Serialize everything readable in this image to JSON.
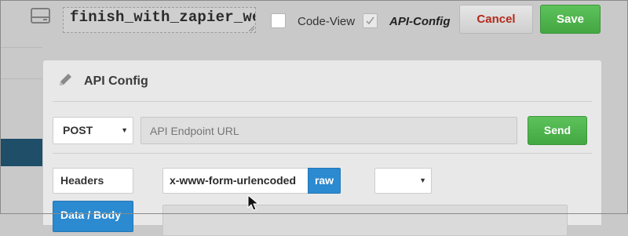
{
  "toolbar": {
    "flow_icon": "computer-icon",
    "flow_name": "finish_with_zapier_webhook.com",
    "code_view_label": "Code-View",
    "code_view_checked": false,
    "api_config_label": "API-Config",
    "api_config_checked": true,
    "cancel_label": "Cancel",
    "save_label": "Save"
  },
  "panel": {
    "title": "API Config",
    "title_icon": "pencil-icon",
    "method": "POST",
    "url_placeholder": "API Endpoint URL",
    "url_value": "",
    "send_label": "Send",
    "tabs": [
      {
        "label": "Headers",
        "active": false
      },
      {
        "label": "Data / Body",
        "active": true
      }
    ],
    "body_types": [
      {
        "label": "x-www-form-urlencoded",
        "active": false
      },
      {
        "label": "raw",
        "active": true
      }
    ],
    "encoding_selected": ""
  },
  "colors": {
    "accent_blue": "#2b8ad0",
    "success_green": "#4cb34a",
    "danger_text": "#b52a1d",
    "header_stripe": "#1e4e68"
  }
}
